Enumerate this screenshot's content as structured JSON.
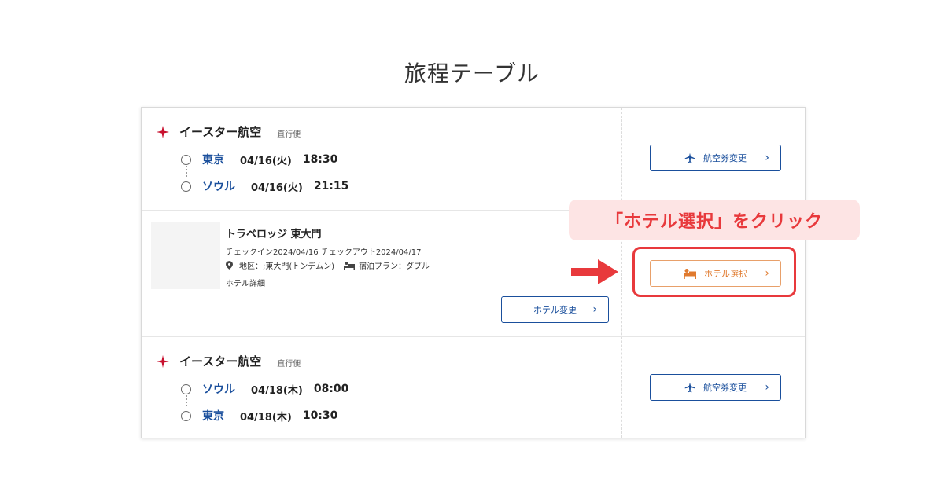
{
  "page": {
    "title": "旅程テーブル"
  },
  "flight1": {
    "airline": "イースター航空",
    "badge": "直行便",
    "departure": {
      "city": "東京",
      "date": "04/16(火)",
      "time": "18:30"
    },
    "arrival": {
      "city": "ソウル",
      "date": "04/16(火)",
      "time": "21:15"
    },
    "change_button": "航空券変更"
  },
  "hotel": {
    "name": "トラベロッジ 東大門",
    "dates": "チェックイン2024/04/16 チェックアウト2024/04/17",
    "area": "地区：;東大門(トンデムン)",
    "plan": "宿泊プラン：ダブル",
    "detail_link": "ホテル詳細",
    "change_button": "ホテル変更",
    "select_button": "ホテル選択"
  },
  "flight2": {
    "airline": "イースター航空",
    "badge": "直行便",
    "departure": {
      "city": "ソウル",
      "date": "04/18(木)",
      "time": "08:00"
    },
    "arrival": {
      "city": "東京",
      "date": "04/18(木)",
      "time": "10:30"
    },
    "change_button": "航空券変更"
  },
  "callout": {
    "text": "「ホテル選択」をクリック"
  },
  "colors": {
    "accent_blue": "#1a4f9c",
    "accent_red": "#e8393c",
    "accent_orange": "#e07a2e"
  }
}
